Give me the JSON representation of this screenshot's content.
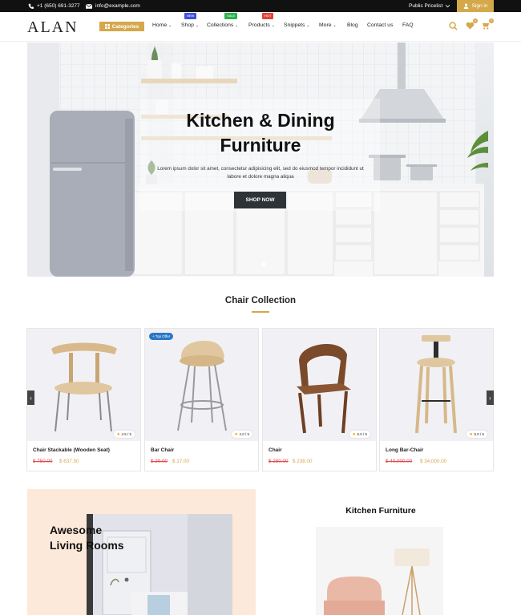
{
  "topbar": {
    "phone": "+1 (650) 691-3277",
    "email": "info@example.com",
    "pricelist": "Public Pricelist",
    "sign_in": "Sign in"
  },
  "header": {
    "logo": "ALAN",
    "categories": "Categories",
    "menu": [
      {
        "label": "Home",
        "chevron": true
      },
      {
        "label": "Shop",
        "chevron": true,
        "badge": "NEW",
        "badge_color": "#3f51e0"
      },
      {
        "label": "Collections",
        "chevron": true,
        "badge": "SALE",
        "badge_color": "#2bb24c"
      },
      {
        "label": "Products",
        "chevron": true,
        "badge": "HOT",
        "badge_color": "#e2423a"
      },
      {
        "label": "Snippets",
        "chevron": true
      },
      {
        "label": "More",
        "chevron": true
      },
      {
        "label": "Blog",
        "chevron": false
      },
      {
        "label": "Contact us",
        "chevron": false
      },
      {
        "label": "FAQ",
        "chevron": false
      }
    ],
    "wishlist_count": "0",
    "cart_count": "0",
    "accent": "#d4a84b"
  },
  "hero": {
    "title_line1": "Kitchen & Dining",
    "title_line2": "Furniture",
    "subtitle": "Lorem ipsum dolor sit amet, consectetur adipisicing elit, sed do eiusmod tempor incididunt ut labore et dolore magna aliqua",
    "button": "SHOP NOW"
  },
  "chair_collection": {
    "title": "Chair Collection",
    "products": [
      {
        "name": "Chair Stackable (Wooden Seat)",
        "old_price": "$ 750.00",
        "price": "$ 637.50",
        "rating": "4.5 / 5"
      },
      {
        "name": "Bar Chair",
        "old_price": "$ 20.00",
        "price": "$ 17.00",
        "rating": "4.0 / 5",
        "tag": "+ Top Offer"
      },
      {
        "name": "Chair",
        "old_price": "$ 280.00",
        "price": "$ 238.00",
        "rating": "5.0 / 5"
      },
      {
        "name": "Long Bar-Chair",
        "old_price": "$ 40,000.00",
        "price": "$ 34,000.00",
        "rating": "5.0 / 5"
      }
    ]
  },
  "promo": {
    "title_line1": "Awesome",
    "title_line2": "Living Rooms"
  },
  "kitchen_furniture": {
    "title": "Kitchen Furniture"
  }
}
